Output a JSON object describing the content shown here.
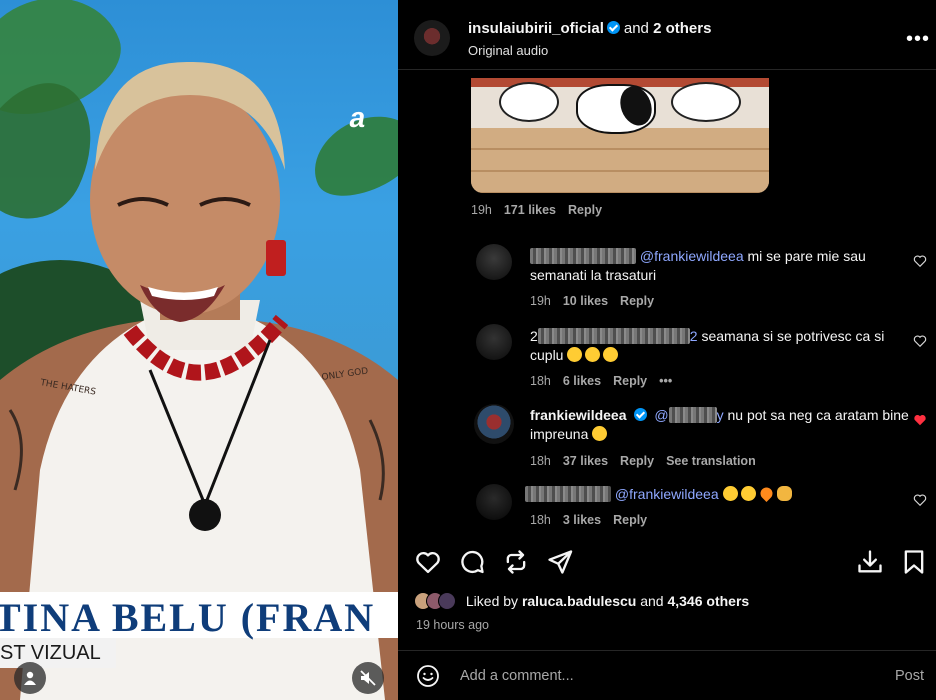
{
  "video": {
    "caption_name": "TINA BELU (FRAN",
    "caption_sub": "ST VIZUAL",
    "channel_logo": "a",
    "user_icon": "user-icon",
    "mute_icon": "muted-speaker-icon"
  },
  "header": {
    "username": "insulaiubirii_oficial",
    "and_text": "and",
    "others": "2 others",
    "audio": "Original audio",
    "more_icon": "more-horizontal-icon"
  },
  "top_comment_meta": {
    "time": "19h",
    "likes": "171 likes",
    "reply": "Reply"
  },
  "comments": [
    {
      "mention": "@frankiewildeea",
      "text": " mi se pare mie sau semanati la trasaturi",
      "time": "19h",
      "likes": "10 likes",
      "reply": "Reply",
      "liked": false
    },
    {
      "prefix": "2",
      "suffix": "2",
      "text": " seamana si se potrivesc ca si cuplu",
      "emojis": [
        "😮",
        "😮",
        "😮"
      ],
      "time": "18h",
      "likes": "6 likes",
      "reply": "Reply",
      "more": "•••",
      "liked": false
    },
    {
      "username": "frankiewildeea",
      "mention_prefix": "@",
      "mention_suffix": "y",
      "text": " nu pot sa neg ca aratam bine impreuna",
      "emojis": [
        "😇"
      ],
      "time": "18h",
      "likes": "37 likes",
      "reply": "Reply",
      "translate": "See translation",
      "liked": true
    },
    {
      "mention": "@frankiewildeea",
      "emojis": [
        "😂",
        "😂",
        "🔥",
        "👏"
      ],
      "time": "18h",
      "likes": "3 likes",
      "reply": "Reply",
      "liked": false
    }
  ],
  "actions": {
    "like_icon": "heart-icon",
    "comment_icon": "comment-icon",
    "repost_icon": "repost-icon",
    "share_icon": "send-icon",
    "download_icon": "download-icon",
    "save_icon": "bookmark-icon"
  },
  "likes": {
    "prefix": "Liked by",
    "user": "raluca.badulescu",
    "and_text": "and",
    "others": "4,346 others"
  },
  "time_ago": "19 hours ago",
  "add_comment": {
    "placeholder": "Add a comment...",
    "post_label": "Post",
    "emoji_icon": "emoji-icon"
  },
  "colors": {
    "accent": "#0095f6",
    "liked_heart": "#ff3040",
    "mention": "#8fa8ff",
    "background": "#000000"
  }
}
